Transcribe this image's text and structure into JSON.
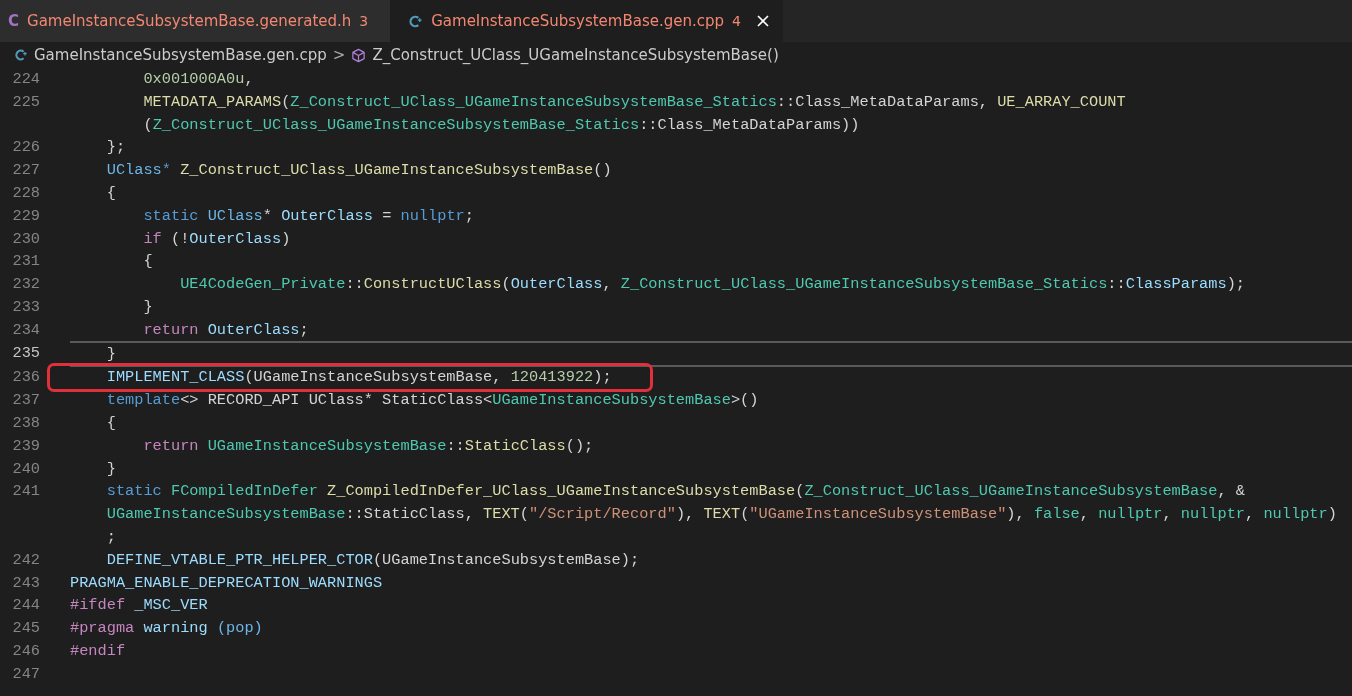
{
  "tabs": [
    {
      "kind": "c",
      "icon_glyph": "C",
      "label": "GameInstanceSubsystemBase.generated.h",
      "count": "3",
      "selected": false
    },
    {
      "kind": "cpp",
      "label": "GameInstanceSubsystemBase.gen.cpp",
      "count": "4",
      "selected": true
    }
  ],
  "breadcrumb": {
    "file": "GameInstanceSubsystemBase.gen.cpp",
    "separator": ">",
    "symbol": "Z_Construct_UClass_UGameInstanceSubsystemBase()"
  },
  "lines": [
    {
      "number": "224",
      "current": false,
      "rows": [
        {
          "spans": [
            {
              "text": "        0x001000A0u",
              "kind": "num"
            },
            {
              "text": ",",
              "kind": "p"
            }
          ]
        }
      ]
    },
    {
      "number": "225",
      "current": false,
      "rows": [
        {
          "spans": [
            {
              "text": "        METADATA_PARAMS",
              "kind": "fn"
            },
            {
              "text": "(",
              "kind": "p"
            },
            {
              "text": "Z_Construct_UClass_UGameInstanceSubsystemBase_Statics",
              "kind": "type"
            },
            {
              "text": "::Class_MetaDataParams,",
              "kind": "p"
            },
            {
              "text": " UE_ARRAY_COUNT",
              "kind": "fn"
            }
          ]
        },
        {
          "spans": [
            {
              "text": "        (",
              "kind": "p"
            },
            {
              "text": "Z_Construct_UClass_UGameInstanceSubsystemBase_Statics",
              "kind": "type"
            },
            {
              "text": "::Class_MetaDataParams))",
              "kind": "p"
            }
          ]
        }
      ]
    },
    {
      "number": "226",
      "current": false,
      "rows": [
        {
          "spans": [
            {
              "text": "    };",
              "kind": "p"
            }
          ]
        }
      ]
    },
    {
      "number": "227",
      "current": false,
      "rows": [
        {
          "spans": [
            {
              "text": "    UClass",
              "kind": "cls"
            },
            {
              "text": "*",
              "kind": "kw"
            },
            {
              "text": " Z_Construct_UClass_UGameInstanceSubsystemBase",
              "kind": "fn"
            },
            {
              "text": "()",
              "kind": "p"
            }
          ]
        }
      ]
    },
    {
      "number": "228",
      "current": false,
      "rows": [
        {
          "spans": [
            {
              "text": "    {",
              "kind": "p"
            }
          ]
        }
      ]
    },
    {
      "number": "229",
      "current": false,
      "rows": [
        {
          "spans": [
            {
              "text": "        static",
              "kind": "kw"
            },
            {
              "text": " UClass",
              "kind": "cls"
            },
            {
              "text": "*",
              "kind": "p"
            },
            {
              "text": " OuterClass",
              "kind": "var"
            },
            {
              "text": " =",
              "kind": "p"
            },
            {
              "text": " nullptr",
              "kind": "kw"
            },
            {
              "text": ";",
              "kind": "p"
            }
          ]
        }
      ]
    },
    {
      "number": "230",
      "current": false,
      "rows": [
        {
          "spans": [
            {
              "text": "        if",
              "kind": "ctrl"
            },
            {
              "text": " (!",
              "kind": "p"
            },
            {
              "text": "OuterClass",
              "kind": "var"
            },
            {
              "text": ")",
              "kind": "p"
            }
          ]
        }
      ]
    },
    {
      "number": "231",
      "current": false,
      "rows": [
        {
          "spans": [
            {
              "text": "        {",
              "kind": "p"
            }
          ]
        }
      ]
    },
    {
      "number": "232",
      "current": false,
      "rows": [
        {
          "spans": [
            {
              "text": "            UE4CodeGen_Private",
              "kind": "type"
            },
            {
              "text": "::",
              "kind": "p"
            },
            {
              "text": "ConstructUClass",
              "kind": "fn"
            },
            {
              "text": "(",
              "kind": "p"
            },
            {
              "text": "OuterClass",
              "kind": "var"
            },
            {
              "text": ",",
              "kind": "p"
            },
            {
              "text": " Z_Construct_UClass_UGameInstanceSubsystemBase_Statics",
              "kind": "type"
            },
            {
              "text": "::",
              "kind": "p"
            },
            {
              "text": "ClassParams",
              "kind": "var"
            },
            {
              "text": ");",
              "kind": "p"
            }
          ]
        }
      ]
    },
    {
      "number": "233",
      "current": false,
      "rows": [
        {
          "spans": [
            {
              "text": "        }",
              "kind": "p"
            }
          ]
        }
      ]
    },
    {
      "number": "234",
      "current": false,
      "rows": [
        {
          "spans": [
            {
              "text": "        return",
              "kind": "ctrl"
            },
            {
              "text": " OuterClass",
              "kind": "var"
            },
            {
              "text": ";",
              "kind": "p"
            }
          ]
        }
      ]
    },
    {
      "number": "235",
      "current": true,
      "rows": [
        {
          "spans": [
            {
              "text": "    }",
              "kind": "p"
            }
          ]
        }
      ]
    },
    {
      "number": "236",
      "current": false,
      "highlighted": true,
      "rows": [
        {
          "spans": [
            {
              "text": "    IMPLEMENT_CLASS",
              "kind": "var"
            },
            {
              "text": "(UGameInstanceSubsystemBase,",
              "kind": "p"
            },
            {
              "text": " 120413922",
              "kind": "num"
            },
            {
              "text": ");",
              "kind": "p"
            }
          ]
        }
      ]
    },
    {
      "number": "237",
      "current": false,
      "rows": [
        {
          "spans": [
            {
              "text": "    template",
              "kind": "kw"
            },
            {
              "text": "<> RECORD_API UClass* StaticClass<",
              "kind": "p"
            },
            {
              "text": "UGameInstanceSubsystemBase",
              "kind": "type"
            },
            {
              "text": ">()",
              "kind": "p"
            }
          ]
        }
      ]
    },
    {
      "number": "238",
      "current": false,
      "rows": [
        {
          "spans": [
            {
              "text": "    {",
              "kind": "p"
            }
          ]
        }
      ]
    },
    {
      "number": "239",
      "current": false,
      "rows": [
        {
          "spans": [
            {
              "text": "        return",
              "kind": "ctrl"
            },
            {
              "text": " UGameInstanceSubsystemBase",
              "kind": "type"
            },
            {
              "text": "::",
              "kind": "p"
            },
            {
              "text": "StaticClass",
              "kind": "fn"
            },
            {
              "text": "();",
              "kind": "p"
            }
          ]
        }
      ]
    },
    {
      "number": "240",
      "current": false,
      "rows": [
        {
          "spans": [
            {
              "text": "    }",
              "kind": "p"
            }
          ]
        }
      ]
    },
    {
      "number": "241",
      "current": false,
      "rows": [
        {
          "spans": [
            {
              "text": "    static",
              "kind": "kw"
            },
            {
              "text": " FCompiledInDefer",
              "kind": "type"
            },
            {
              "text": " Z_CompiledInDefer_UClass_UGameInstanceSubsystemBase",
              "kind": "fn"
            },
            {
              "text": "(",
              "kind": "p"
            },
            {
              "text": "Z_Construct_UClass_UGameInstanceSubsystemBase",
              "kind": "type"
            },
            {
              "text": ", &",
              "kind": "p"
            }
          ]
        },
        {
          "spans": [
            {
              "text": "    UGameInstanceSubsystemBase",
              "kind": "type"
            },
            {
              "text": "::StaticClass,",
              "kind": "p"
            },
            {
              "text": " TEXT",
              "kind": "fn"
            },
            {
              "text": "(",
              "kind": "p"
            },
            {
              "text": "\"/Script/Record\"",
              "kind": "str"
            },
            {
              "text": "),",
              "kind": "p"
            },
            {
              "text": " TEXT",
              "kind": "fn"
            },
            {
              "text": "(",
              "kind": "p"
            },
            {
              "text": "\"UGameInstanceSubsystemBase\"",
              "kind": "str"
            },
            {
              "text": "),",
              "kind": "p"
            },
            {
              "text": " false",
              "kind": "type"
            },
            {
              "text": ",",
              "kind": "p"
            },
            {
              "text": " nullptr",
              "kind": "type"
            },
            {
              "text": ",",
              "kind": "p"
            },
            {
              "text": " nullptr",
              "kind": "type"
            },
            {
              "text": ",",
              "kind": "p"
            },
            {
              "text": " nullptr",
              "kind": "type"
            },
            {
              "text": ")",
              "kind": "p"
            }
          ]
        },
        {
          "spans": [
            {
              "text": "    ;",
              "kind": "p"
            }
          ]
        }
      ]
    },
    {
      "number": "242",
      "current": false,
      "rows": [
        {
          "spans": [
            {
              "text": "    DEFINE_VTABLE_PTR_HELPER_CTOR",
              "kind": "var"
            },
            {
              "text": "(UGameInstanceSubsystemBase);",
              "kind": "p"
            }
          ]
        }
      ]
    },
    {
      "number": "243",
      "current": false,
      "rows": [
        {
          "spans": [
            {
              "text": "PRAGMA_ENABLE_DEPRECATION_WARNINGS",
              "kind": "var"
            }
          ]
        }
      ]
    },
    {
      "number": "244",
      "current": false,
      "rows": [
        {
          "spans": [
            {
              "text": "#ifdef",
              "kind": "ctrl"
            },
            {
              "text": " _MSC_VER",
              "kind": "var"
            }
          ]
        }
      ]
    },
    {
      "number": "245",
      "current": false,
      "rows": [
        {
          "spans": [
            {
              "text": "#pragma",
              "kind": "ctrl"
            },
            {
              "text": " warning",
              "kind": "var"
            },
            {
              "text": " (pop)",
              "kind": "cls"
            }
          ]
        }
      ]
    },
    {
      "number": "246",
      "current": false,
      "rows": [
        {
          "spans": [
            {
              "text": "#endif",
              "kind": "ctrl"
            }
          ]
        }
      ]
    },
    {
      "number": "247"
    }
  ]
}
